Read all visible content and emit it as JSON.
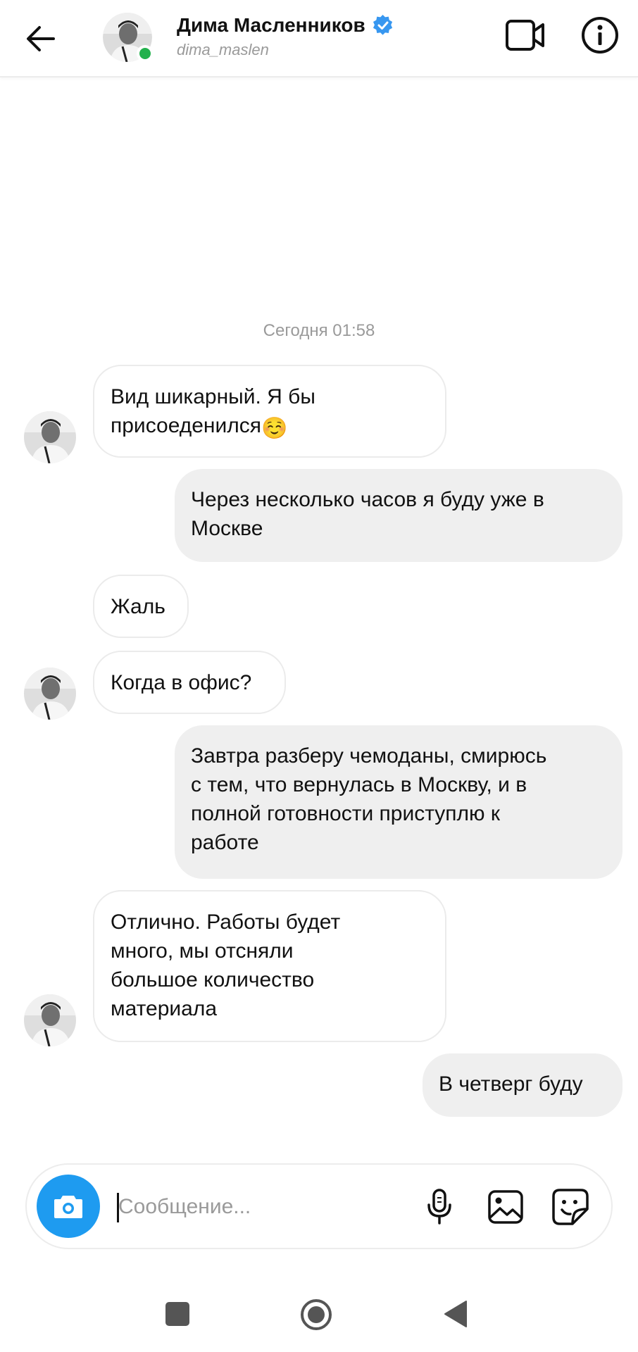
{
  "header": {
    "name": "Дима Масленников",
    "username": "dima_maslen",
    "back_icon": "arrow-left-icon",
    "video_icon": "video-camera-icon",
    "info_icon": "info-icon",
    "verified_color": "#3797f0",
    "online_color": "#22b14c"
  },
  "conversation": {
    "timestamp": "Сегодня 01:58",
    "messages": [
      {
        "direction": "incoming",
        "line1": "Вид шикарный. Я бы",
        "line2": "присоеденился",
        "emoji": "☺️"
      },
      {
        "direction": "outgoing",
        "line1": "Через несколько часов я буду уже в",
        "line2": "Москве"
      },
      {
        "direction": "incoming",
        "text": "Жаль"
      },
      {
        "direction": "incoming",
        "text": "Когда в офис?"
      },
      {
        "direction": "outgoing",
        "line1": "Завтра разберу чемоданы, смирюсь",
        "line2": "с тем, что вернулась в Москву, и в",
        "line3": "полной готовности приступлю к",
        "line4": "работе"
      },
      {
        "direction": "incoming",
        "line1": "Отлично. Работы будет",
        "line2": "много, мы отсняли",
        "line3": "большое количество",
        "line4": "материала"
      },
      {
        "direction": "outgoing",
        "text": "В четверг буду"
      }
    ]
  },
  "composer": {
    "placeholder": "Сообщение...",
    "value": "",
    "camera_icon": "camera-icon",
    "mic_icon": "microphone-icon",
    "gallery_icon": "image-icon",
    "sticker_icon": "sticker-icon",
    "accent": "#1e9bf0"
  },
  "system_nav": {
    "recent_icon": "square-recents-icon",
    "home_icon": "circle-home-icon",
    "back_icon": "triangle-back-icon"
  }
}
